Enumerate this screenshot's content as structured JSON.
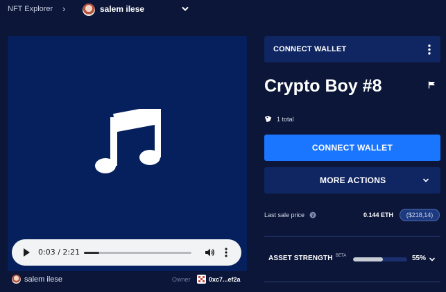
{
  "breadcrumb": {
    "root": "NFT Explorer",
    "separator": "›",
    "user": "salem ilese"
  },
  "media": {
    "icon": "music-note-icon",
    "player": {
      "time": "0:03 / 2:21",
      "progress_fraction": 0.14
    }
  },
  "owner": {
    "name": "salem ilese",
    "label": "Owner",
    "address": "0xc7...ef2a"
  },
  "header": {
    "connect_wallet": "CONNECT WALLET"
  },
  "asset": {
    "title": "Crypto Boy #8",
    "total": "1 total"
  },
  "actions": {
    "connect_wallet": "CONNECT WALLET",
    "more_actions": "MORE ACTIONS"
  },
  "sale": {
    "label": "Last sale price",
    "eth": "0.144 ETH",
    "usd": "($218,14)"
  },
  "strength": {
    "label": "ASSET STRENGTH",
    "beta": "BETA",
    "value": "55%",
    "fraction": 0.55
  },
  "colors": {
    "background": "#0b1638",
    "media_panel": "#06205d",
    "accent": "#1a75ff",
    "panel": "#102662"
  }
}
